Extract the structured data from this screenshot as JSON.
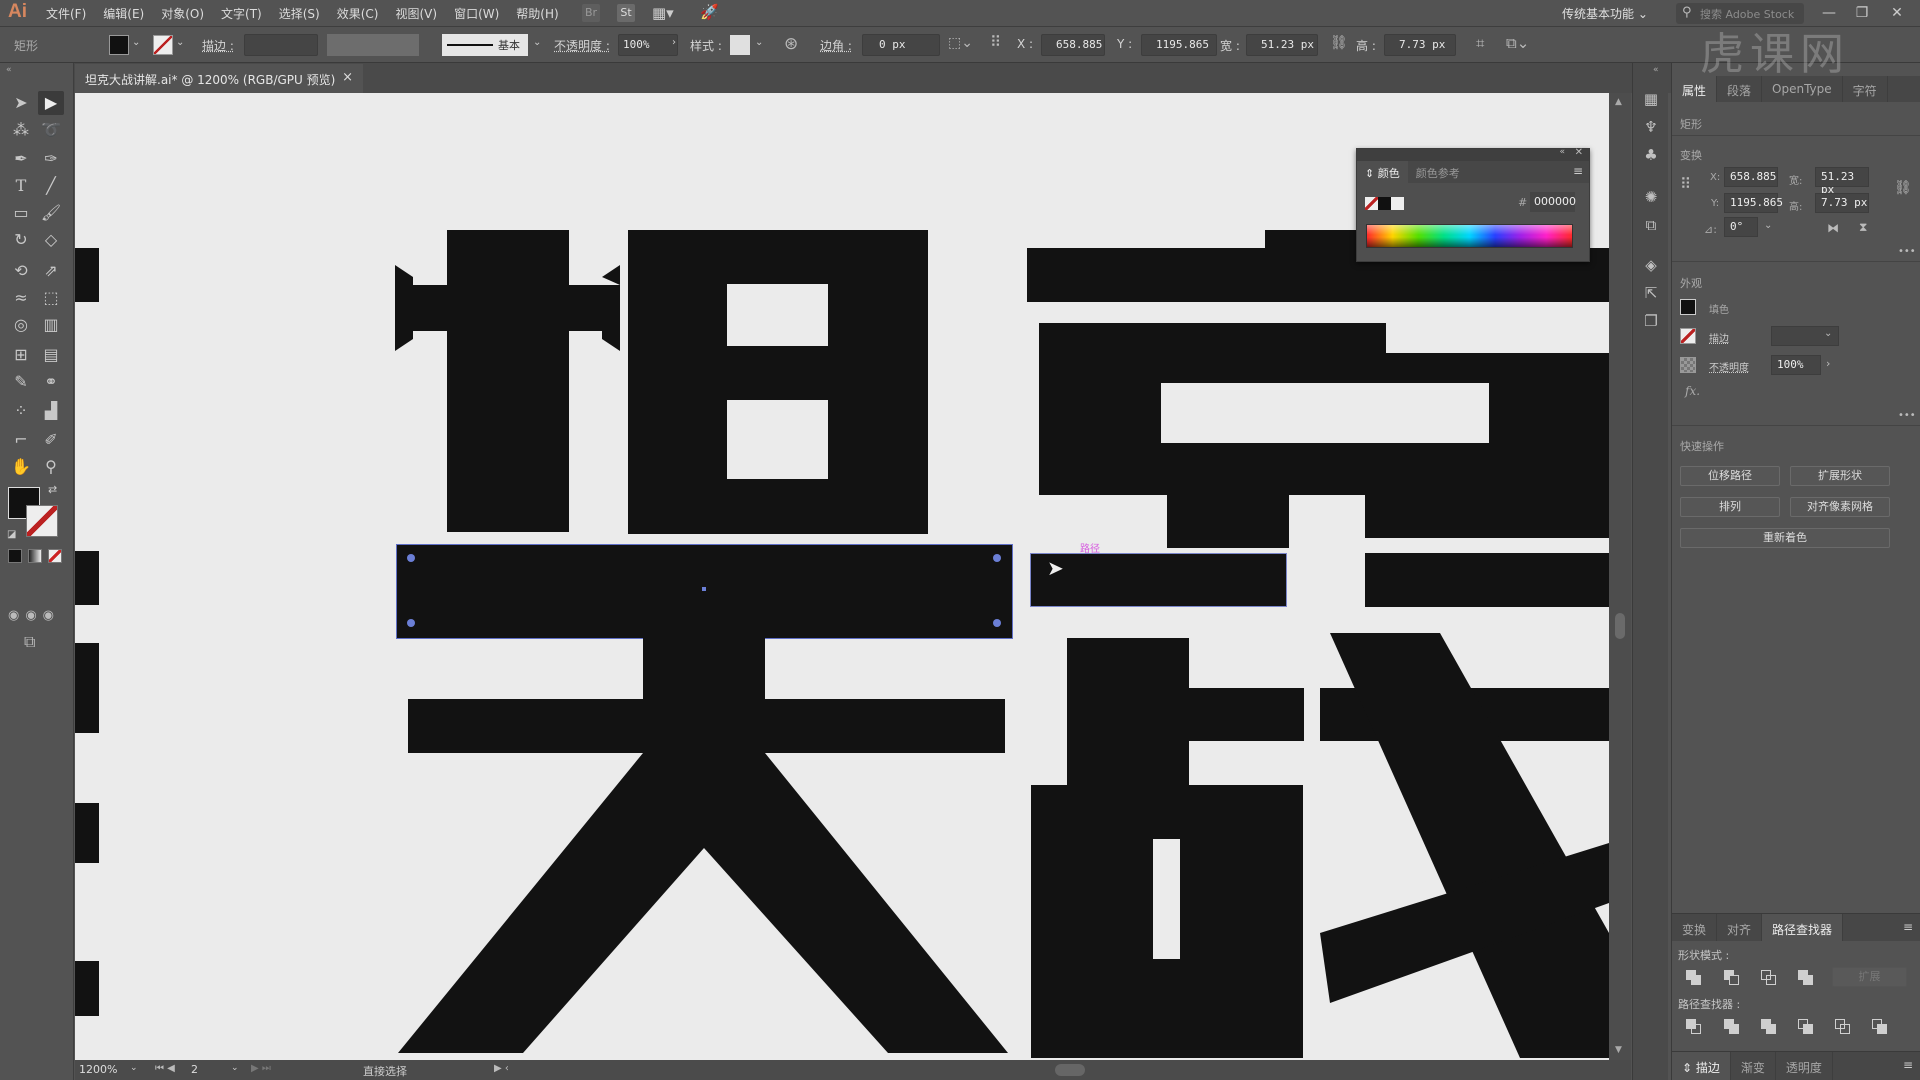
{
  "app": {
    "logo": "Ai"
  },
  "menu": [
    "文件(F)",
    "编辑(E)",
    "对象(O)",
    "文字(T)",
    "选择(S)",
    "效果(C)",
    "视图(V)",
    "窗口(W)",
    "帮助(H)"
  ],
  "menubar_icons": {
    "bridge": "Br",
    "stock": "St"
  },
  "workspace": "传统基本功能",
  "search_stock_placeholder": "搜索 Adobe Stock",
  "window_controls": {
    "minimize": "—",
    "restore": "❐",
    "close": "✕"
  },
  "control_bar": {
    "object_type": "矩形",
    "stroke_label": "描边 :",
    "stroke_style": "基本",
    "opacity_label": "不透明度 :",
    "opacity_value": "100%",
    "style_label": "样式 :",
    "corner_label": "边角 :",
    "corner_value": "0 px",
    "x_label": "X :",
    "x_value": "658.885",
    "y_label": "Y :",
    "y_value": "1195.865",
    "w_label": "宽 :",
    "w_value": "51.23 px",
    "h_label": "高 :",
    "h_value": "7.73 px"
  },
  "document_tab": {
    "title": "坦克大战讲解.ai* @ 1200% (RGB/GPU 预览)",
    "close": "×"
  },
  "canvas": {
    "hover_label": "路径",
    "fill_color": "#121212",
    "bg_color": "#ebebeb",
    "selection_color": "#5f6fc7"
  },
  "status_bar": {
    "zoom": "1200%",
    "artboard": "2",
    "tool": "直接选择"
  },
  "color_panel": {
    "tabs": [
      "颜色",
      "颜色参考"
    ],
    "hex_label": "#",
    "hex_value": "000000"
  },
  "properties_panel": {
    "tabs": [
      "属性",
      "段落",
      "OpenType",
      "字符"
    ],
    "object_type": "矩形",
    "transform_title": "变换",
    "x_label": "X:",
    "x_value": "658.885",
    "y_label": "Y:",
    "y_value": "1195.865",
    "w_label": "宽:",
    "w_value": "51.23 px",
    "h_label": "高:",
    "h_value": "7.73 px",
    "angle_label": "⊿:",
    "angle_value": "0°",
    "appearance_title": "外观",
    "fill_label": "填色",
    "stroke_label": "描边",
    "opacity_label": "不透明度",
    "opacity_value": "100%",
    "fx_label": "fx.",
    "more": "•••",
    "quick_actions_title": "快速操作",
    "quick_actions": [
      "位移路径",
      "扩展形状",
      "排列",
      "对齐像素网格",
      "重新着色"
    ]
  },
  "pathfinder_panel": {
    "tabs": [
      "变换",
      "对齐",
      "路径查找器"
    ],
    "shape_modes_title": "形状模式 :",
    "expand_label": "扩展",
    "pathfinders_title": "路径查找器 :"
  },
  "bottom_panel_tabs": [
    "描边",
    "渐变",
    "透明度"
  ],
  "watermark": "虎课网"
}
